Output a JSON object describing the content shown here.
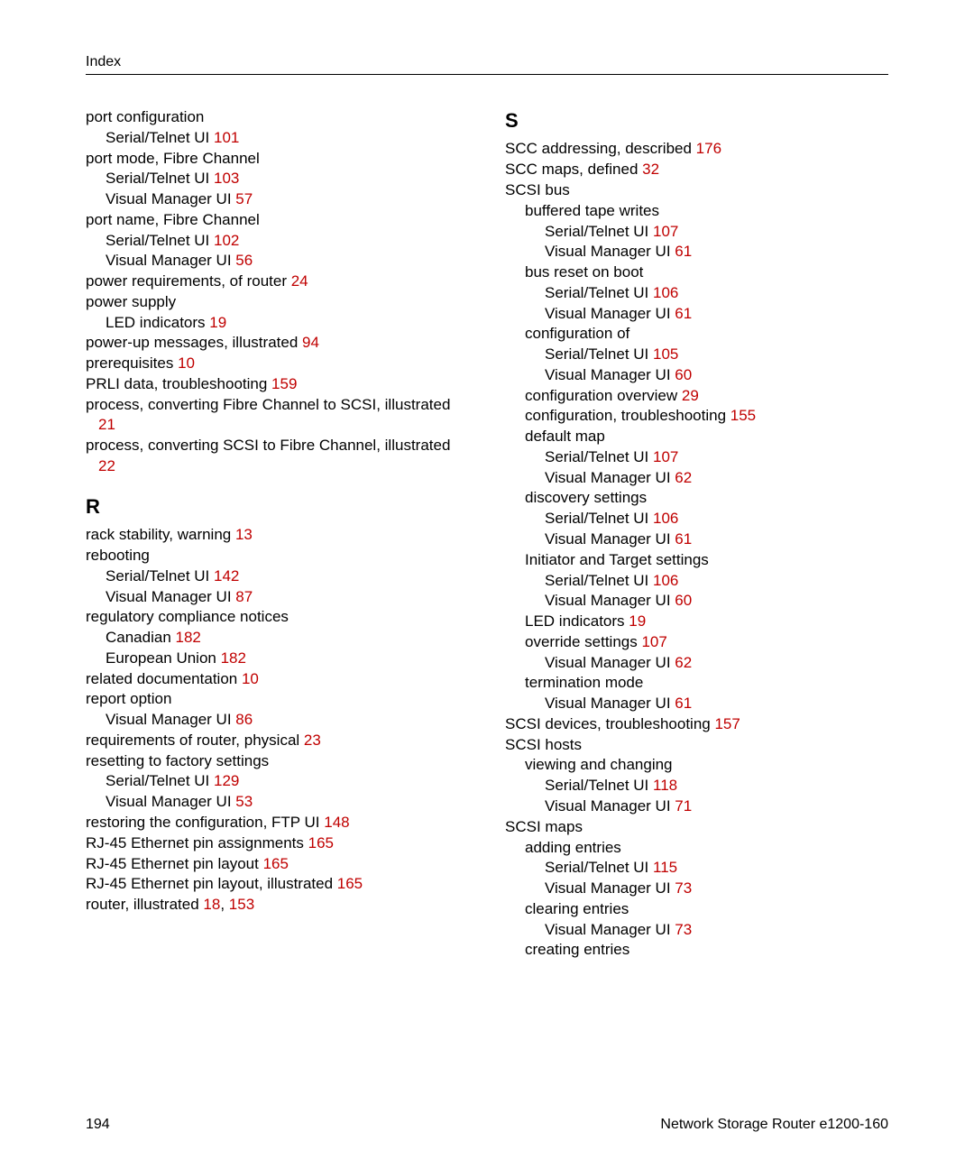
{
  "header": {
    "title": "Index"
  },
  "footer": {
    "page_number": "194",
    "doc_title": "Network Storage Router e1200-160"
  },
  "left_column": [
    {
      "t": "entry",
      "text": "port configuration"
    },
    {
      "t": "sub1",
      "text": "Serial/Telnet UI ",
      "page": "101"
    },
    {
      "t": "entry",
      "text": "port mode, Fibre Channel"
    },
    {
      "t": "sub1",
      "text": "Serial/Telnet UI ",
      "page": "103"
    },
    {
      "t": "sub1",
      "text": "Visual Manager UI ",
      "page": "57"
    },
    {
      "t": "entry",
      "text": "port name, Fibre Channel"
    },
    {
      "t": "sub1",
      "text": "Serial/Telnet UI ",
      "page": "102"
    },
    {
      "t": "sub1",
      "text": "Visual Manager UI ",
      "page": "56"
    },
    {
      "t": "entry",
      "text": "power requirements, of router ",
      "page": "24"
    },
    {
      "t": "entry",
      "text": "power supply"
    },
    {
      "t": "sub1",
      "text": "LED indicators ",
      "page": "19"
    },
    {
      "t": "entry",
      "text": "power-up messages, illustrated ",
      "page": "94"
    },
    {
      "t": "entry",
      "text": "prerequisites ",
      "page": "10"
    },
    {
      "t": "entry",
      "text": "PRLI data, troubleshooting ",
      "page": "159"
    },
    {
      "t": "entry",
      "text": "process, converting Fibre Channel to SCSI, illustrated ",
      "page": "21",
      "hanging": true
    },
    {
      "t": "entry",
      "text": "process, converting SCSI to Fibre Channel, illustrated ",
      "page": "22",
      "hanging": true
    },
    {
      "t": "letter",
      "text": "R"
    },
    {
      "t": "entry",
      "text": "rack stability, warning ",
      "page": "13"
    },
    {
      "t": "entry",
      "text": "rebooting"
    },
    {
      "t": "sub1",
      "text": "Serial/Telnet UI ",
      "page": "142"
    },
    {
      "t": "sub1",
      "text": "Visual Manager UI ",
      "page": "87"
    },
    {
      "t": "entry",
      "text": "regulatory compliance notices"
    },
    {
      "t": "sub1",
      "text": "Canadian ",
      "page": "182"
    },
    {
      "t": "sub1",
      "text": "European Union ",
      "page": "182"
    },
    {
      "t": "entry",
      "text": "related documentation ",
      "page": "10"
    },
    {
      "t": "entry",
      "text": "report option"
    },
    {
      "t": "sub1",
      "text": "Visual Manager UI ",
      "page": "86"
    },
    {
      "t": "entry",
      "text": "requirements of router, physical ",
      "page": "23"
    },
    {
      "t": "entry",
      "text": "resetting to factory settings"
    },
    {
      "t": "sub1",
      "text": "Serial/Telnet UI ",
      "page": "129"
    },
    {
      "t": "sub1",
      "text": "Visual Manager UI ",
      "page": "53"
    },
    {
      "t": "entry",
      "text": "restoring the configuration, FTP UI ",
      "page": "148"
    },
    {
      "t": "entry",
      "text": "RJ-45 Ethernet pin assignments ",
      "page": "165"
    },
    {
      "t": "entry",
      "text": "RJ-45 Ethernet pin layout ",
      "page": "165"
    },
    {
      "t": "entry",
      "text": "RJ-45 Ethernet pin layout, illustrated ",
      "page": "165"
    },
    {
      "t": "entry",
      "text": "router, illustrated ",
      "pages": [
        "18",
        "153"
      ]
    }
  ],
  "right_column": [
    {
      "t": "letter",
      "text": "S",
      "first": true
    },
    {
      "t": "entry",
      "text": "SCC addressing, described ",
      "page": "176"
    },
    {
      "t": "entry",
      "text": "SCC maps, defined ",
      "page": "32"
    },
    {
      "t": "entry",
      "text": "SCSI bus"
    },
    {
      "t": "sub1",
      "text": "buffered tape writes"
    },
    {
      "t": "sub2",
      "text": "Serial/Telnet UI ",
      "page": "107"
    },
    {
      "t": "sub2",
      "text": "Visual Manager UI ",
      "page": "61"
    },
    {
      "t": "sub1",
      "text": "bus reset on boot"
    },
    {
      "t": "sub2",
      "text": "Serial/Telnet UI ",
      "page": "106"
    },
    {
      "t": "sub2",
      "text": "Visual Manager UI ",
      "page": "61"
    },
    {
      "t": "sub1",
      "text": "configuration of"
    },
    {
      "t": "sub2",
      "text": "Serial/Telnet UI ",
      "page": "105"
    },
    {
      "t": "sub2",
      "text": "Visual Manager UI ",
      "page": "60"
    },
    {
      "t": "sub1",
      "text": "configuration overview ",
      "page": "29"
    },
    {
      "t": "sub1",
      "text": "configuration, troubleshooting ",
      "page": "155"
    },
    {
      "t": "sub1",
      "text": "default map"
    },
    {
      "t": "sub2",
      "text": "Serial/Telnet UI ",
      "page": "107"
    },
    {
      "t": "sub2",
      "text": "Visual Manager UI ",
      "page": "62"
    },
    {
      "t": "sub1",
      "text": "discovery settings"
    },
    {
      "t": "sub2",
      "text": "Serial/Telnet UI ",
      "page": "106"
    },
    {
      "t": "sub2",
      "text": "Visual Manager UI ",
      "page": "61"
    },
    {
      "t": "sub1",
      "text": "Initiator and Target settings"
    },
    {
      "t": "sub2",
      "text": "Serial/Telnet UI ",
      "page": "106"
    },
    {
      "t": "sub2",
      "text": "Visual Manager UI ",
      "page": "60"
    },
    {
      "t": "sub1",
      "text": "LED indicators ",
      "page": "19"
    },
    {
      "t": "sub1",
      "text": "override settings ",
      "page": "107"
    },
    {
      "t": "sub2",
      "text": "Visual Manager UI ",
      "page": "62"
    },
    {
      "t": "sub1",
      "text": "termination mode"
    },
    {
      "t": "sub2",
      "text": "Visual Manager UI ",
      "page": "61"
    },
    {
      "t": "entry",
      "text": "SCSI devices, troubleshooting ",
      "page": "157"
    },
    {
      "t": "entry",
      "text": "SCSI hosts"
    },
    {
      "t": "sub1",
      "text": "viewing and changing"
    },
    {
      "t": "sub2",
      "text": "Serial/Telnet UI ",
      "page": "118"
    },
    {
      "t": "sub2",
      "text": "Visual Manager UI ",
      "page": "71"
    },
    {
      "t": "entry",
      "text": "SCSI maps"
    },
    {
      "t": "sub1",
      "text": "adding entries"
    },
    {
      "t": "sub2",
      "text": "Serial/Telnet UI ",
      "page": "115"
    },
    {
      "t": "sub2",
      "text": "Visual Manager UI ",
      "page": "73"
    },
    {
      "t": "sub1",
      "text": "clearing entries"
    },
    {
      "t": "sub2",
      "text": "Visual Manager UI ",
      "page": "73"
    },
    {
      "t": "sub1",
      "text": "creating entries"
    }
  ]
}
